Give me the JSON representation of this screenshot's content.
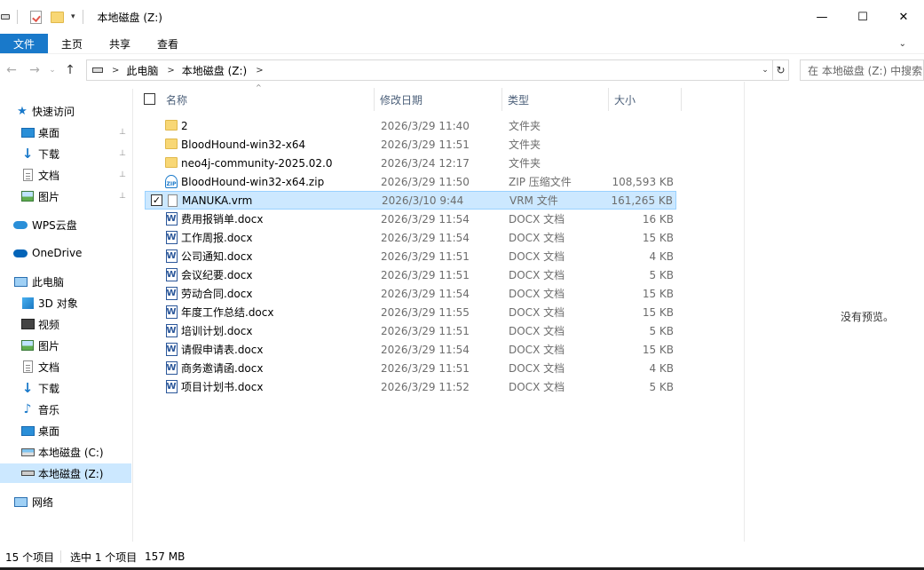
{
  "window": {
    "title": "本地磁盘 (Z:)",
    "minimize": "—",
    "maximize": "☐",
    "close": "✕"
  },
  "ribbon": {
    "tabs": [
      "文件",
      "主页",
      "共享",
      "查看"
    ],
    "expand": "⌄"
  },
  "nav": {
    "back": "←",
    "forward": "→",
    "recent": "⌄",
    "up": "↑"
  },
  "address": {
    "crumbs": [
      "此电脑",
      "本地磁盘 (Z:)"
    ],
    "separator": ">",
    "dropdown": "⌄",
    "refresh": "↻"
  },
  "search": {
    "placeholder": "在 本地磁盘 (Z:) 中搜索"
  },
  "sidebar": {
    "items": [
      {
        "label": "快速访问",
        "icon": "star-icon"
      },
      {
        "label": "桌面",
        "icon": "desktop-icon",
        "pinned": true
      },
      {
        "label": "下载",
        "icon": "download-icon",
        "pinned": true
      },
      {
        "label": "文档",
        "icon": "document-icon",
        "pinned": true
      },
      {
        "label": "图片",
        "icon": "pictures-icon",
        "pinned": true
      },
      {
        "label": "WPS云盘",
        "icon": "cloud-icon"
      },
      {
        "label": "OneDrive",
        "icon": "onedrive-icon"
      },
      {
        "label": "此电脑",
        "icon": "computer-icon"
      },
      {
        "label": "3D 对象",
        "icon": "3d-objects-icon"
      },
      {
        "label": "视频",
        "icon": "video-icon"
      },
      {
        "label": "图片",
        "icon": "pictures-icon"
      },
      {
        "label": "文档",
        "icon": "document-icon"
      },
      {
        "label": "下载",
        "icon": "download-icon"
      },
      {
        "label": "音乐",
        "icon": "music-icon"
      },
      {
        "label": "桌面",
        "icon": "desktop-icon"
      },
      {
        "label": "本地磁盘 (C:)",
        "icon": "drive-c-icon"
      },
      {
        "label": "本地磁盘 (Z:)",
        "icon": "drive-z-icon",
        "selected": true
      },
      {
        "label": "网络",
        "icon": "network-icon"
      }
    ],
    "pin_glyph": "📌"
  },
  "columns": {
    "name": "名称",
    "modified": "修改日期",
    "type": "类型",
    "size": "大小",
    "sort_glyph": "^"
  },
  "files": [
    {
      "name": "2",
      "date": "2026/3/29 11:40",
      "type": "文件夹",
      "size": "",
      "icon": "folder-icon"
    },
    {
      "name": "BloodHound-win32-x64",
      "date": "2026/3/29 11:51",
      "type": "文件夹",
      "size": "",
      "icon": "folder-icon"
    },
    {
      "name": "neo4j-community-2025.02.0",
      "date": "2026/3/24 12:17",
      "type": "文件夹",
      "size": "",
      "icon": "folder-icon"
    },
    {
      "name": "BloodHound-win32-x64.zip",
      "date": "2026/3/29 11:50",
      "type": "ZIP 压缩文件",
      "size": "108,593 KB",
      "icon": "zip-icon"
    },
    {
      "name": "MANUKA.vrm",
      "date": "2026/3/10 9:44",
      "type": "VRM 文件",
      "size": "161,265 KB",
      "icon": "file-icon",
      "selected": true
    },
    {
      "name": "费用报销单.docx",
      "date": "2026/3/29 11:54",
      "type": "DOCX 文档",
      "size": "16 KB",
      "icon": "word-icon"
    },
    {
      "name": "工作周报.docx",
      "date": "2026/3/29 11:54",
      "type": "DOCX 文档",
      "size": "15 KB",
      "icon": "word-icon"
    },
    {
      "name": "公司通知.docx",
      "date": "2026/3/29 11:51",
      "type": "DOCX 文档",
      "size": "4 KB",
      "icon": "word-icon"
    },
    {
      "name": "会议纪要.docx",
      "date": "2026/3/29 11:51",
      "type": "DOCX 文档",
      "size": "5 KB",
      "icon": "word-icon"
    },
    {
      "name": "劳动合同.docx",
      "date": "2026/3/29 11:54",
      "type": "DOCX 文档",
      "size": "15 KB",
      "icon": "word-icon"
    },
    {
      "name": "年度工作总结.docx",
      "date": "2026/3/29 11:55",
      "type": "DOCX 文档",
      "size": "15 KB",
      "icon": "word-icon"
    },
    {
      "name": "培训计划.docx",
      "date": "2026/3/29 11:51",
      "type": "DOCX 文档",
      "size": "5 KB",
      "icon": "word-icon"
    },
    {
      "name": "请假申请表.docx",
      "date": "2026/3/29 11:54",
      "type": "DOCX 文档",
      "size": "15 KB",
      "icon": "word-icon"
    },
    {
      "name": "商务邀请函.docx",
      "date": "2026/3/29 11:51",
      "type": "DOCX 文档",
      "size": "4 KB",
      "icon": "word-icon"
    },
    {
      "name": "项目计划书.docx",
      "date": "2026/3/29 11:52",
      "type": "DOCX 文档",
      "size": "5 KB",
      "icon": "word-icon"
    }
  ],
  "preview": {
    "text": "没有预览。"
  },
  "status": {
    "count": "15 个项目",
    "selected": "选中 1 个项目",
    "size": "157 MB"
  },
  "colors": {
    "accent": "#1979ca",
    "selection": "#cce8ff",
    "selection_border": "#99d1ff"
  }
}
